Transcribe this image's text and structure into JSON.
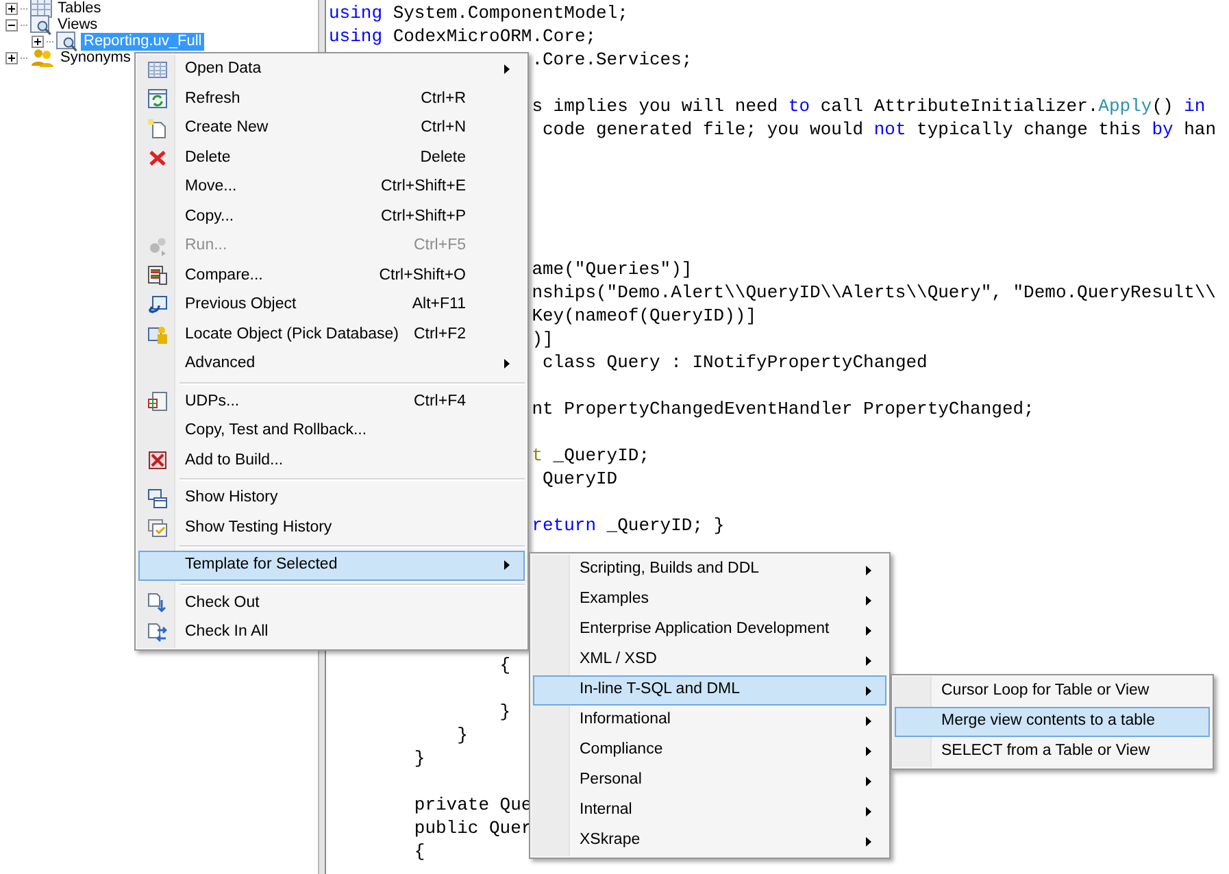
{
  "tree": [
    {
      "label": "Tables",
      "kind": "tables",
      "expanded": false
    },
    {
      "label": "Views",
      "kind": "views",
      "expanded": true,
      "children": [
        {
          "label": "Reporting.uv_Full",
          "kind": "view",
          "expanded": false,
          "selected": true
        }
      ]
    },
    {
      "label": "Synonyms",
      "kind": "synonyms",
      "expanded": false
    }
  ],
  "code_lines": [
    [
      {
        "kind": "keyword",
        "text": "using"
      },
      {
        "kind": "plain",
        "text": " System.ComponentModel;"
      }
    ],
    [
      {
        "kind": "keyword",
        "text": "using"
      },
      {
        "kind": "plain",
        "text": " CodexMicroORM.Core;"
      }
    ],
    [
      {
        "kind": "plain",
        "text": ".Core.Services;"
      }
    ],
    [
      {
        "kind": "plain",
        "text": "s implies you will need "
      },
      {
        "kind": "keyword",
        "text": "to"
      },
      {
        "kind": "plain",
        "text": " call AttributeInitializer."
      },
      {
        "kind": "method",
        "text": "Apply"
      },
      {
        "kind": "plain",
        "text": "() "
      },
      {
        "kind": "keyword",
        "text": "in"
      }
    ],
    [
      {
        "kind": "plain",
        "text": "code generated file; you would "
      },
      {
        "kind": "keyword",
        "text": "not"
      },
      {
        "kind": "plain",
        "text": " typically change this "
      },
      {
        "kind": "keyword",
        "text": "by"
      },
      {
        "kind": "plain",
        "text": " han"
      }
    ],
    [
      {
        "kind": "plain",
        "text": "ame(\"Queries\")]"
      }
    ],
    [
      {
        "kind": "plain",
        "text": "nships(\"Demo.Alert\\\\QueryID\\\\Alerts\\\\Query\", \"Demo.QueryResult\\\\"
      }
    ],
    [
      {
        "kind": "plain",
        "text": "Key(nameof(QueryID))]"
      }
    ],
    [
      {
        "kind": "plain",
        "text": ")]"
      }
    ],
    [
      {
        "kind": "plain",
        "text": "class Query : INotifyPropertyChanged"
      }
    ],
    [
      {
        "kind": "plain",
        "text": "nt PropertyChangedEventHandler PropertyChanged;"
      }
    ],
    [
      {
        "kind": "type",
        "text": "t"
      },
      {
        "kind": "plain",
        "text": " _QueryID;"
      }
    ],
    [
      {
        "kind": "plain",
        "text": "QueryID"
      }
    ],
    [
      {
        "kind": "keyword",
        "text": "return"
      },
      {
        "kind": "plain",
        "text": " _QueryID; }"
      }
    ],
    [
      {
        "kind": "plain",
        "text": "{"
      }
    ],
    [
      {
        "kind": "plain",
        "text": "}"
      }
    ],
    [
      {
        "kind": "plain",
        "text": "}"
      }
    ],
    [
      {
        "kind": "plain",
        "text": "}"
      }
    ],
    [
      {
        "kind": "plain",
        "text": "private Que"
      }
    ],
    [
      {
        "kind": "plain",
        "text": "public Quer"
      }
    ],
    [
      {
        "kind": "plain",
        "text": "{"
      }
    ]
  ],
  "context_menu": [
    {
      "kind": "item",
      "label": "Open Data",
      "has_submenu": true,
      "disabled": false,
      "selected": false
    },
    {
      "kind": "item",
      "label": "Refresh",
      "shortcut": "Ctrl+R",
      "has_submenu": false,
      "disabled": false,
      "selected": false
    },
    {
      "kind": "item",
      "label": "Create New",
      "shortcut": "Ctrl+N",
      "has_submenu": false,
      "disabled": false,
      "selected": false
    },
    {
      "kind": "item",
      "label": "Delete",
      "shortcut": "Delete",
      "has_submenu": false,
      "disabled": false,
      "selected": false
    },
    {
      "kind": "item",
      "label": "Move...",
      "shortcut": "Ctrl+Shift+E",
      "has_submenu": false,
      "disabled": false,
      "selected": false
    },
    {
      "kind": "item",
      "label": "Copy...",
      "shortcut": "Ctrl+Shift+P",
      "has_submenu": false,
      "disabled": false,
      "selected": false
    },
    {
      "kind": "item",
      "label": "Run...",
      "shortcut": "Ctrl+F5",
      "has_submenu": false,
      "disabled": true,
      "selected": false
    },
    {
      "kind": "item",
      "label": "Compare...",
      "shortcut": "Ctrl+Shift+O",
      "has_submenu": false,
      "disabled": false,
      "selected": false
    },
    {
      "kind": "item",
      "label": "Previous Object",
      "shortcut": "Alt+F11",
      "has_submenu": false,
      "disabled": false,
      "selected": false
    },
    {
      "kind": "item",
      "label": "Locate Object (Pick Database)",
      "shortcut": "Ctrl+F2",
      "has_submenu": false,
      "disabled": false,
      "selected": false
    },
    {
      "kind": "item",
      "label": "Advanced",
      "has_submenu": true,
      "disabled": false,
      "selected": false
    },
    {
      "kind": "separator"
    },
    {
      "kind": "item",
      "label": "UDPs...",
      "shortcut": "Ctrl+F4",
      "has_submenu": false,
      "disabled": false,
      "selected": false
    },
    {
      "kind": "item",
      "label": "Copy, Test and Rollback...",
      "has_submenu": false,
      "disabled": false,
      "selected": false
    },
    {
      "kind": "item",
      "label": "Add to Build...",
      "has_submenu": false,
      "disabled": false,
      "selected": false
    },
    {
      "kind": "separator"
    },
    {
      "kind": "item",
      "label": "Show History",
      "has_submenu": false,
      "disabled": false,
      "selected": false
    },
    {
      "kind": "item",
      "label": "Show Testing History",
      "has_submenu": false,
      "disabled": false,
      "selected": false
    },
    {
      "kind": "separator"
    },
    {
      "kind": "item",
      "label": "Template for Selected",
      "has_submenu": true,
      "disabled": false,
      "selected": true
    },
    {
      "kind": "separator"
    },
    {
      "kind": "item",
      "label": "Check Out",
      "has_submenu": false,
      "disabled": false,
      "selected": false
    },
    {
      "kind": "item",
      "label": "Check In All",
      "has_submenu": false,
      "disabled": false,
      "selected": false
    }
  ],
  "template_submenu": [
    {
      "kind": "item",
      "label": "Scripting, Builds and DDL",
      "has_submenu": true,
      "selected": false
    },
    {
      "kind": "item",
      "label": "Examples",
      "has_submenu": true,
      "selected": false
    },
    {
      "kind": "item",
      "label": "Enterprise Application Development",
      "has_submenu": true,
      "selected": false
    },
    {
      "kind": "item",
      "label": "XML / XSD",
      "has_submenu": true,
      "selected": false
    },
    {
      "kind": "item",
      "label": "In-line T-SQL and DML",
      "has_submenu": true,
      "selected": true
    },
    {
      "kind": "item",
      "label": "Informational",
      "has_submenu": true,
      "selected": false
    },
    {
      "kind": "item",
      "label": "Compliance",
      "has_submenu": true,
      "selected": false
    },
    {
      "kind": "item",
      "label": "Personal",
      "has_submenu": true,
      "selected": false
    },
    {
      "kind": "item",
      "label": "Internal",
      "has_submenu": true,
      "selected": false
    },
    {
      "kind": "item",
      "label": "XSkrape",
      "has_submenu": true,
      "selected": false
    }
  ],
  "tsql_submenu": [
    {
      "kind": "item",
      "label": "Cursor Loop for Table or View",
      "has_submenu": false,
      "selected": false
    },
    {
      "kind": "item",
      "label": "Merge view contents to a table",
      "has_submenu": false,
      "selected": true
    },
    {
      "kind": "item",
      "label": "SELECT from a Table or View",
      "has_submenu": false,
      "selected": false
    }
  ]
}
